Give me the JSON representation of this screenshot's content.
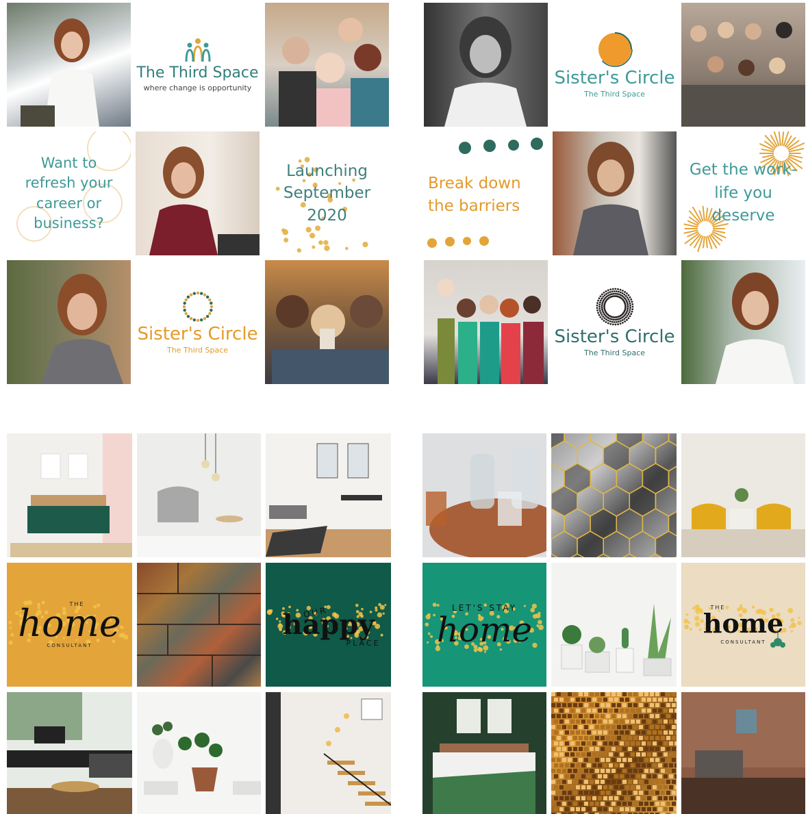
{
  "grid_top_left": {
    "logo_title": "The Third Space",
    "logo_tagline": "where change is opportunity",
    "quote_refresh": "Want to refresh your career or business?",
    "launching": "Launching September 2020",
    "sc_title": "Sister's Circle",
    "sc_sub": "The Third Space"
  },
  "grid_top_right": {
    "sc_title_1": "Sister's Circle",
    "sc_sub_1": "The Third Space",
    "break_down": "Break down the barriers",
    "get_worklife": "Get the work-life you deserve",
    "sc_title_2": "Sister's Circle",
    "sc_sub_2": "The Third Space"
  },
  "grid_bottom_left": {
    "home_the": "THE",
    "home_word": "home",
    "home_consultant": "CONSULTANT",
    "happy_our": "OUR",
    "happy_word": "happy",
    "happy_place": "PLACE"
  },
  "grid_bottom_right": {
    "stay_top": "LET'S STAY",
    "stay_word": "home",
    "home2_the": "THE",
    "home2_word": "home",
    "home2_consultant": "CONSULTANT"
  },
  "colors": {
    "teal": "#3d9a98",
    "orange": "#e39a2a",
    "mustard": "#e3a43a",
    "forest": "#0f5a48",
    "jade": "#169577",
    "beige": "#ebdcc2"
  },
  "photo_subjects": [
    "woman-in-white-blouse-office",
    "four-smiling-women",
    "woman-black-and-white-portrait",
    "group-of-women-on-sofa",
    "woman-red-top-brick-wall",
    "woman-plaid-shirt-window",
    "woman-plaid-shirt-plants",
    "women-drinking-coffee",
    "five-women-celebrating",
    "woman-white-shirt-plants",
    "bedroom-green-blanket",
    "grey-armchair-pendant-lights",
    "bright-dining-room",
    "slate-stone-texture",
    "tropical-living-room",
    "potted-plants-books",
    "staircase-interior",
    "glass-bottles-copper-tray",
    "marble-hexagon-tiles",
    "yellow-armchairs",
    "succulents-on-shelf",
    "green-bedroom",
    "gold-sequin-texture",
    "brick-wall-lounge"
  ]
}
